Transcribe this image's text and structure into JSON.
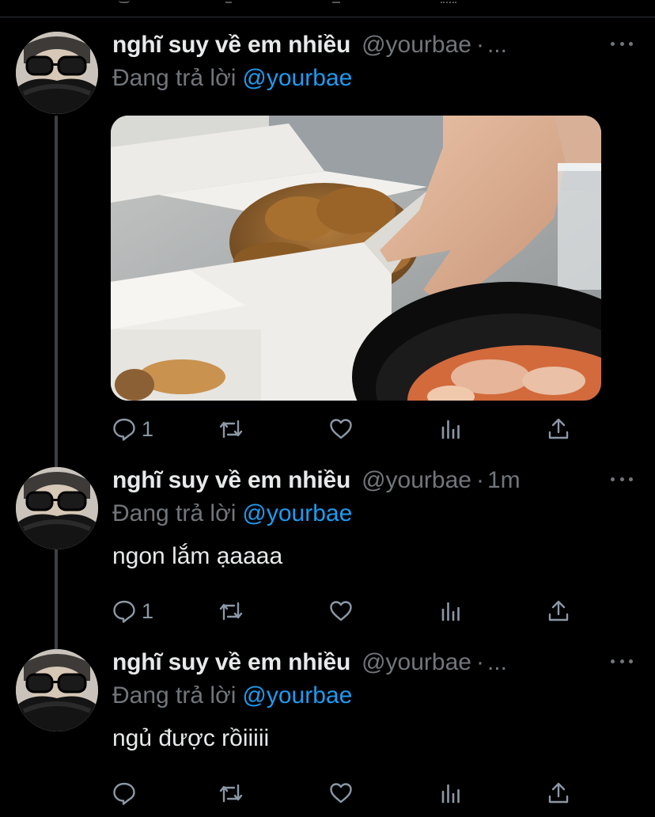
{
  "colors": {
    "background": "#000000",
    "text": "#e7e9ea",
    "muted": "#71767b",
    "accent": "#1d9bf0",
    "divider": "#2f3336"
  },
  "tweets": [
    {
      "display_name": "nghĩ suy về em nhiều",
      "handle": "@yourbae",
      "separator": "·",
      "time": "...",
      "replying_label": "Đang trả lời",
      "replying_to": "@yourbae",
      "text": "",
      "has_media": true,
      "reply_count": "1",
      "icons": [
        "reply-icon",
        "retweet-icon",
        "like-icon",
        "stats-icon",
        "share-icon"
      ]
    },
    {
      "display_name": "nghĩ suy về em nhiều",
      "handle": "@yourbae",
      "separator": "·",
      "time": "1m",
      "replying_label": "Đang trả lời",
      "replying_to": "@yourbae",
      "text": "ngon lắm ạaaaa",
      "has_media": false,
      "reply_count": "1",
      "icons": [
        "reply-icon",
        "retweet-icon",
        "like-icon",
        "stats-icon",
        "share-icon"
      ]
    },
    {
      "display_name": "nghĩ suy về em nhiều",
      "handle": "@yourbae",
      "separator": "·",
      "time": "...",
      "replying_label": "Đang trả lời",
      "replying_to": "@yourbae",
      "text": "ngủ được rồiiiii",
      "has_media": false,
      "reply_count": "",
      "icons": [
        "reply-icon",
        "retweet-icon",
        "like-icon",
        "stats-icon",
        "share-icon"
      ]
    }
  ]
}
